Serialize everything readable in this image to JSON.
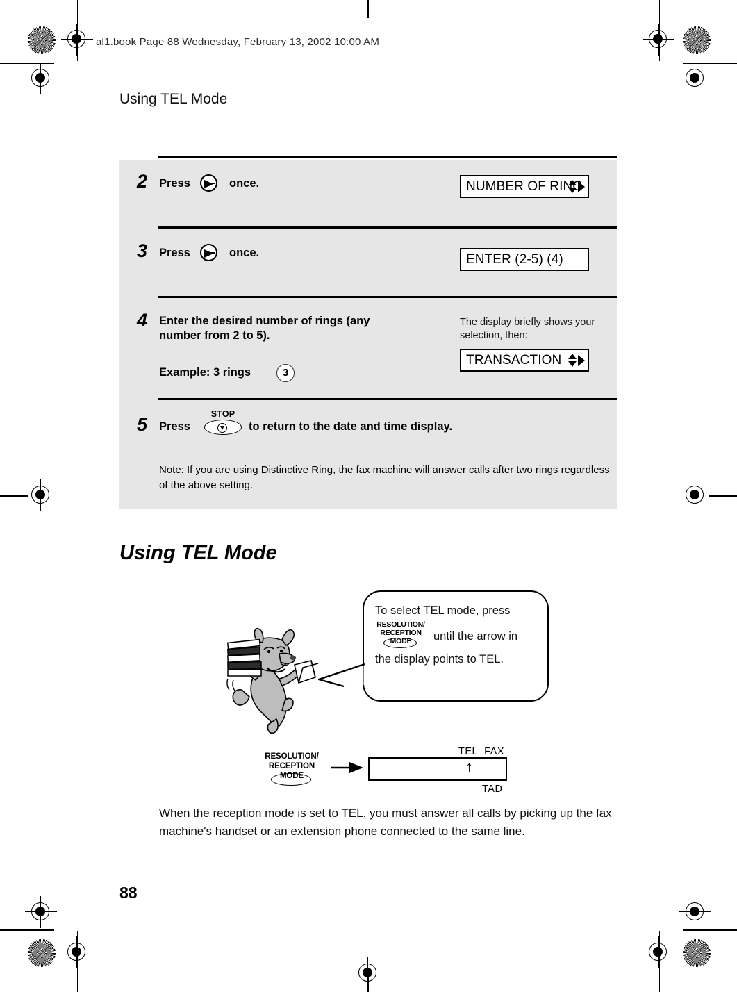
{
  "page": {
    "file_header": "al1.book  Page 88  Wednesday,  February 13, 2002  10:00 AM",
    "running_head": "Using TEL Mode",
    "folio": "88"
  },
  "procedure": {
    "steps": [
      {
        "number": "2",
        "text": "Press        once.",
        "key_icon": "right-arrow-key-icon",
        "display": "NUMBER OF RING",
        "display_arrows": "up-down-right-arrows-icon"
      },
      {
        "number": "3",
        "text": "Press        once.",
        "key_icon": "right-arrow-key-icon",
        "display": "ENTER (2-5) (4)",
        "display_arrows": ""
      },
      {
        "number": "4",
        "text": "Enter the desired number of rings (any number from 2 to 5).",
        "example_label": "Example: 3 rings",
        "example_key": "3",
        "caption": "The display briefly shows your selection, then:",
        "display": "TRANSACTION",
        "display_arrows": "up-down-right-arrows-icon"
      },
      {
        "number": "5",
        "text_before": "Press",
        "stop_key_label": "STOP",
        "text_after": "to return to the date and time display."
      }
    ],
    "note": "Note: If you are using Distinctive Ring, the fax machine will answer calls after two rings regardless of the above setting."
  },
  "section": {
    "heading": "Using TEL Mode",
    "bubble": {
      "line1": "To select TEL mode, press",
      "key_line1": "RESOLUTION/",
      "key_line2": "RECEPTION MODE",
      "line2": "until the arrow in",
      "line3": "the display points to TEL."
    },
    "diagram": {
      "key_line1": "RESOLUTION/",
      "key_line2": "RECEPTION MODE",
      "display_label_tel": "TEL",
      "display_label_fax": "FAX",
      "display_label_tad": "TAD",
      "pointer_glyph": "↑"
    },
    "paragraph": "When the reception mode is set to TEL, you must answer all calls by picking up the fax machine's handset or an extension phone connected to the same line."
  },
  "colors": {
    "panel_bg": "#e6e6e6",
    "rule": "#000000",
    "text": "#111111"
  }
}
